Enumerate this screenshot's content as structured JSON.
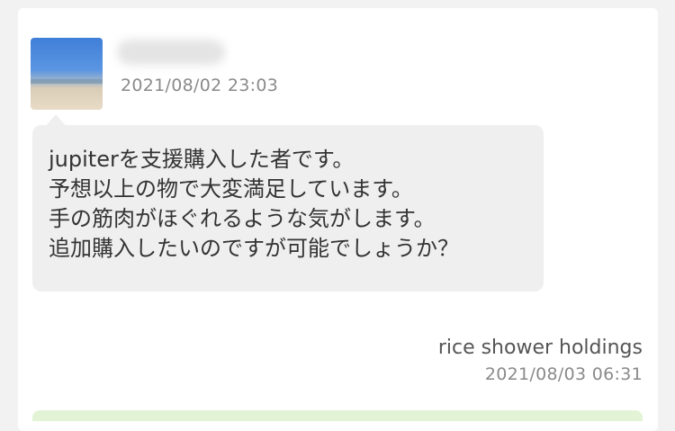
{
  "received_message": {
    "timestamp": "2021/08/02 23:03",
    "lines": [
      "jupiterを支援購入した者です。",
      "予想以上の物で大変満足しています。",
      "手の筋肉がほぐれるような気がします。",
      "追加購入したいのですが可能でしょうか？"
    ]
  },
  "reply_message": {
    "sender": "rice shower holdings",
    "timestamp": "2021/08/03 06:31"
  },
  "colors": {
    "received_bubble": "#efefef",
    "reply_bubble": "#e3f3d6"
  }
}
